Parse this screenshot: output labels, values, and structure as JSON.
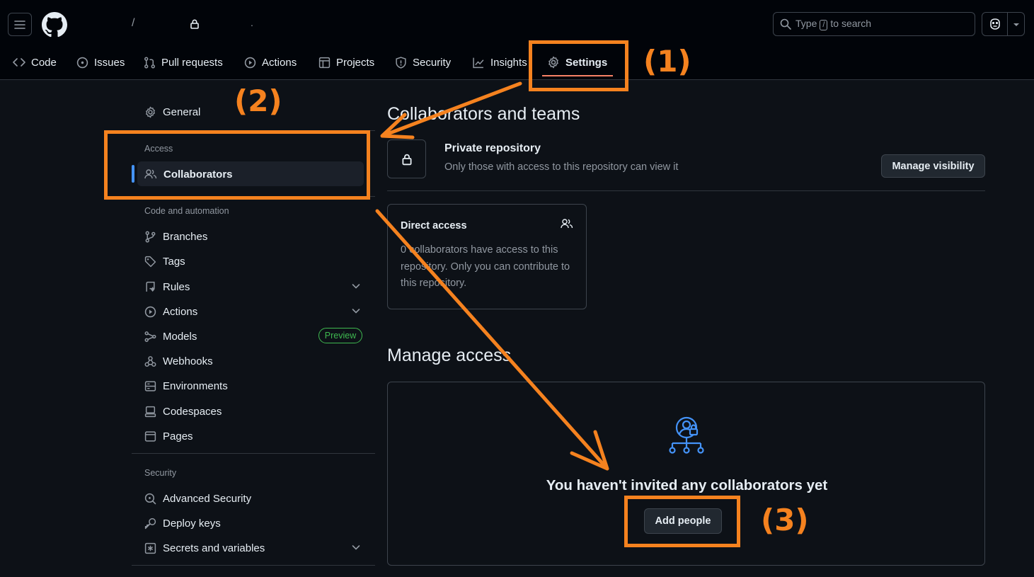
{
  "header": {
    "crumb_separator": "/",
    "crumb_trailing": ".",
    "search": {
      "prefix": "Type",
      "key": "/",
      "suffix": "to search"
    }
  },
  "nav": {
    "tabs": [
      {
        "label": "Code",
        "icon": "code-icon"
      },
      {
        "label": "Issues",
        "icon": "issue-icon"
      },
      {
        "label": "Pull requests",
        "icon": "pull-request-icon"
      },
      {
        "label": "Actions",
        "icon": "play-icon"
      },
      {
        "label": "Projects",
        "icon": "table-icon"
      },
      {
        "label": "Security",
        "icon": "shield-icon"
      },
      {
        "label": "Insights",
        "icon": "graph-icon"
      },
      {
        "label": "Settings",
        "icon": "gear-icon",
        "active": true
      }
    ]
  },
  "sidebar": {
    "general": "General",
    "access_heading": "Access",
    "collaborators": "Collaborators",
    "code_heading": "Code and automation",
    "branches": "Branches",
    "tags": "Tags",
    "rules": "Rules",
    "actions": "Actions",
    "models": "Models",
    "preview_badge": "Preview",
    "webhooks": "Webhooks",
    "environments": "Environments",
    "codespaces": "Codespaces",
    "pages": "Pages",
    "security_heading": "Security",
    "advanced_security": "Advanced Security",
    "deploy_keys": "Deploy keys",
    "secrets": "Secrets and variables"
  },
  "main": {
    "collab_title": "Collaborators and teams",
    "private_title": "Private repository",
    "private_desc": "Only those with access to this repository can view it",
    "manage_visibility": "Manage visibility",
    "direct_access_title": "Direct access",
    "direct_access_text": "0 collaborators have access to this repository. Only you can contribute to this repository.",
    "manage_access_title": "Manage access",
    "empty_title": "You haven't invited any collaborators yet",
    "add_people": "Add people"
  },
  "annotations": {
    "step1": "(1)",
    "step2": "(2)",
    "step3": "(3)",
    "color": "#f5821f"
  },
  "colors": {
    "background": "#0d1117",
    "header_bg": "#010409",
    "accent_blue": "#4493f8",
    "tab_underline": "#f78166",
    "preview_green": "#3fb950"
  }
}
